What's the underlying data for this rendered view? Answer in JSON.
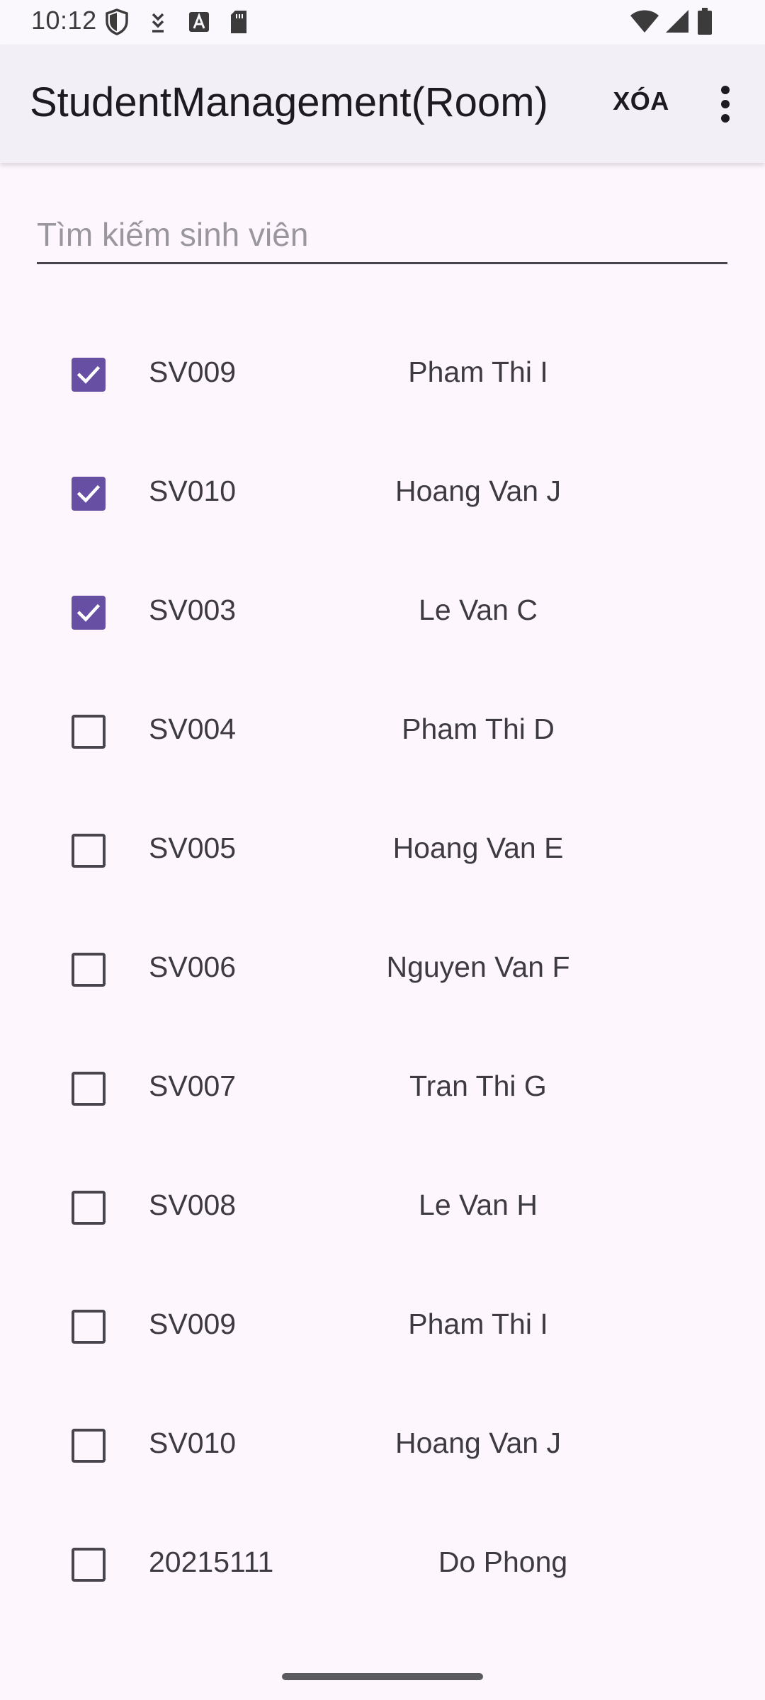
{
  "status_bar": {
    "time": "10:12",
    "left_icons": [
      "shield-icon",
      "download-icon",
      "a-box-icon",
      "sd-card-icon"
    ],
    "right_icons": [
      "wifi-icon",
      "signal-icon",
      "battery-icon"
    ]
  },
  "app_bar": {
    "title": "StudentManagement(Room)",
    "delete_label": "XÓA",
    "overflow_icon": "more-vert-icon"
  },
  "search": {
    "placeholder": "Tìm kiếm sinh viên",
    "value": ""
  },
  "colors": {
    "accent": "#6750a4",
    "background": "#fdf7fd",
    "app_bar": "#f3eff6"
  },
  "students": [
    {
      "id": "SV009",
      "name": "Pham Thi I",
      "checked": true
    },
    {
      "id": "SV010",
      "name": "Hoang Van J",
      "checked": true
    },
    {
      "id": "SV003",
      "name": "Le Van C",
      "checked": true
    },
    {
      "id": "SV004",
      "name": "Pham Thi D",
      "checked": false
    },
    {
      "id": "SV005",
      "name": "Hoang Van E",
      "checked": false
    },
    {
      "id": "SV006",
      "name": "Nguyen Van F",
      "checked": false
    },
    {
      "id": "SV007",
      "name": "Tran Thi G",
      "checked": false
    },
    {
      "id": "SV008",
      "name": "Le Van H",
      "checked": false
    },
    {
      "id": "SV009",
      "name": "Pham Thi I",
      "checked": false
    },
    {
      "id": "SV010",
      "name": "Hoang Van J",
      "checked": false
    },
    {
      "id": "20215111",
      "name": "Do Phong",
      "checked": false
    }
  ]
}
